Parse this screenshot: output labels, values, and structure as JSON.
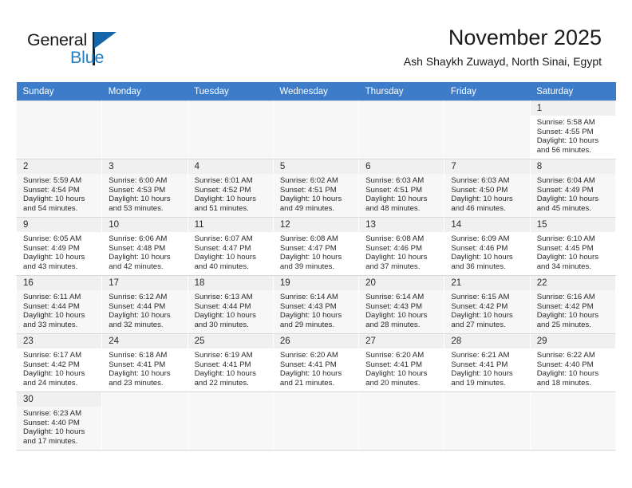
{
  "brand": {
    "name_part1": "General",
    "name_part2": "Blue",
    "accent_color": "#1f7fc4"
  },
  "header": {
    "title": "November 2025",
    "subtitle": "Ash Shaykh Zuwayd, North Sinai, Egypt"
  },
  "calendar": {
    "header_bg": "#3d7cc9",
    "weekdays": [
      "Sunday",
      "Monday",
      "Tuesday",
      "Wednesday",
      "Thursday",
      "Friday",
      "Saturday"
    ],
    "weeks": [
      [
        {
          "day": "",
          "sunrise": "",
          "sunset": "",
          "daylight1": "",
          "daylight2": ""
        },
        {
          "day": "",
          "sunrise": "",
          "sunset": "",
          "daylight1": "",
          "daylight2": ""
        },
        {
          "day": "",
          "sunrise": "",
          "sunset": "",
          "daylight1": "",
          "daylight2": ""
        },
        {
          "day": "",
          "sunrise": "",
          "sunset": "",
          "daylight1": "",
          "daylight2": ""
        },
        {
          "day": "",
          "sunrise": "",
          "sunset": "",
          "daylight1": "",
          "daylight2": ""
        },
        {
          "day": "",
          "sunrise": "",
          "sunset": "",
          "daylight1": "",
          "daylight2": ""
        },
        {
          "day": "1",
          "sunrise": "Sunrise: 5:58 AM",
          "sunset": "Sunset: 4:55 PM",
          "daylight1": "Daylight: 10 hours",
          "daylight2": "and 56 minutes."
        }
      ],
      [
        {
          "day": "2",
          "sunrise": "Sunrise: 5:59 AM",
          "sunset": "Sunset: 4:54 PM",
          "daylight1": "Daylight: 10 hours",
          "daylight2": "and 54 minutes."
        },
        {
          "day": "3",
          "sunrise": "Sunrise: 6:00 AM",
          "sunset": "Sunset: 4:53 PM",
          "daylight1": "Daylight: 10 hours",
          "daylight2": "and 53 minutes."
        },
        {
          "day": "4",
          "sunrise": "Sunrise: 6:01 AM",
          "sunset": "Sunset: 4:52 PM",
          "daylight1": "Daylight: 10 hours",
          "daylight2": "and 51 minutes."
        },
        {
          "day": "5",
          "sunrise": "Sunrise: 6:02 AM",
          "sunset": "Sunset: 4:51 PM",
          "daylight1": "Daylight: 10 hours",
          "daylight2": "and 49 minutes."
        },
        {
          "day": "6",
          "sunrise": "Sunrise: 6:03 AM",
          "sunset": "Sunset: 4:51 PM",
          "daylight1": "Daylight: 10 hours",
          "daylight2": "and 48 minutes."
        },
        {
          "day": "7",
          "sunrise": "Sunrise: 6:03 AM",
          "sunset": "Sunset: 4:50 PM",
          "daylight1": "Daylight: 10 hours",
          "daylight2": "and 46 minutes."
        },
        {
          "day": "8",
          "sunrise": "Sunrise: 6:04 AM",
          "sunset": "Sunset: 4:49 PM",
          "daylight1": "Daylight: 10 hours",
          "daylight2": "and 45 minutes."
        }
      ],
      [
        {
          "day": "9",
          "sunrise": "Sunrise: 6:05 AM",
          "sunset": "Sunset: 4:49 PM",
          "daylight1": "Daylight: 10 hours",
          "daylight2": "and 43 minutes."
        },
        {
          "day": "10",
          "sunrise": "Sunrise: 6:06 AM",
          "sunset": "Sunset: 4:48 PM",
          "daylight1": "Daylight: 10 hours",
          "daylight2": "and 42 minutes."
        },
        {
          "day": "11",
          "sunrise": "Sunrise: 6:07 AM",
          "sunset": "Sunset: 4:47 PM",
          "daylight1": "Daylight: 10 hours",
          "daylight2": "and 40 minutes."
        },
        {
          "day": "12",
          "sunrise": "Sunrise: 6:08 AM",
          "sunset": "Sunset: 4:47 PM",
          "daylight1": "Daylight: 10 hours",
          "daylight2": "and 39 minutes."
        },
        {
          "day": "13",
          "sunrise": "Sunrise: 6:08 AM",
          "sunset": "Sunset: 4:46 PM",
          "daylight1": "Daylight: 10 hours",
          "daylight2": "and 37 minutes."
        },
        {
          "day": "14",
          "sunrise": "Sunrise: 6:09 AM",
          "sunset": "Sunset: 4:46 PM",
          "daylight1": "Daylight: 10 hours",
          "daylight2": "and 36 minutes."
        },
        {
          "day": "15",
          "sunrise": "Sunrise: 6:10 AM",
          "sunset": "Sunset: 4:45 PM",
          "daylight1": "Daylight: 10 hours",
          "daylight2": "and 34 minutes."
        }
      ],
      [
        {
          "day": "16",
          "sunrise": "Sunrise: 6:11 AM",
          "sunset": "Sunset: 4:44 PM",
          "daylight1": "Daylight: 10 hours",
          "daylight2": "and 33 minutes."
        },
        {
          "day": "17",
          "sunrise": "Sunrise: 6:12 AM",
          "sunset": "Sunset: 4:44 PM",
          "daylight1": "Daylight: 10 hours",
          "daylight2": "and 32 minutes."
        },
        {
          "day": "18",
          "sunrise": "Sunrise: 6:13 AM",
          "sunset": "Sunset: 4:44 PM",
          "daylight1": "Daylight: 10 hours",
          "daylight2": "and 30 minutes."
        },
        {
          "day": "19",
          "sunrise": "Sunrise: 6:14 AM",
          "sunset": "Sunset: 4:43 PM",
          "daylight1": "Daylight: 10 hours",
          "daylight2": "and 29 minutes."
        },
        {
          "day": "20",
          "sunrise": "Sunrise: 6:14 AM",
          "sunset": "Sunset: 4:43 PM",
          "daylight1": "Daylight: 10 hours",
          "daylight2": "and 28 minutes."
        },
        {
          "day": "21",
          "sunrise": "Sunrise: 6:15 AM",
          "sunset": "Sunset: 4:42 PM",
          "daylight1": "Daylight: 10 hours",
          "daylight2": "and 27 minutes."
        },
        {
          "day": "22",
          "sunrise": "Sunrise: 6:16 AM",
          "sunset": "Sunset: 4:42 PM",
          "daylight1": "Daylight: 10 hours",
          "daylight2": "and 25 minutes."
        }
      ],
      [
        {
          "day": "23",
          "sunrise": "Sunrise: 6:17 AM",
          "sunset": "Sunset: 4:42 PM",
          "daylight1": "Daylight: 10 hours",
          "daylight2": "and 24 minutes."
        },
        {
          "day": "24",
          "sunrise": "Sunrise: 6:18 AM",
          "sunset": "Sunset: 4:41 PM",
          "daylight1": "Daylight: 10 hours",
          "daylight2": "and 23 minutes."
        },
        {
          "day": "25",
          "sunrise": "Sunrise: 6:19 AM",
          "sunset": "Sunset: 4:41 PM",
          "daylight1": "Daylight: 10 hours",
          "daylight2": "and 22 minutes."
        },
        {
          "day": "26",
          "sunrise": "Sunrise: 6:20 AM",
          "sunset": "Sunset: 4:41 PM",
          "daylight1": "Daylight: 10 hours",
          "daylight2": "and 21 minutes."
        },
        {
          "day": "27",
          "sunrise": "Sunrise: 6:20 AM",
          "sunset": "Sunset: 4:41 PM",
          "daylight1": "Daylight: 10 hours",
          "daylight2": "and 20 minutes."
        },
        {
          "day": "28",
          "sunrise": "Sunrise: 6:21 AM",
          "sunset": "Sunset: 4:41 PM",
          "daylight1": "Daylight: 10 hours",
          "daylight2": "and 19 minutes."
        },
        {
          "day": "29",
          "sunrise": "Sunrise: 6:22 AM",
          "sunset": "Sunset: 4:40 PM",
          "daylight1": "Daylight: 10 hours",
          "daylight2": "and 18 minutes."
        }
      ],
      [
        {
          "day": "30",
          "sunrise": "Sunrise: 6:23 AM",
          "sunset": "Sunset: 4:40 PM",
          "daylight1": "Daylight: 10 hours",
          "daylight2": "and 17 minutes."
        },
        {
          "day": "",
          "sunrise": "",
          "sunset": "",
          "daylight1": "",
          "daylight2": ""
        },
        {
          "day": "",
          "sunrise": "",
          "sunset": "",
          "daylight1": "",
          "daylight2": ""
        },
        {
          "day": "",
          "sunrise": "",
          "sunset": "",
          "daylight1": "",
          "daylight2": ""
        },
        {
          "day": "",
          "sunrise": "",
          "sunset": "",
          "daylight1": "",
          "daylight2": ""
        },
        {
          "day": "",
          "sunrise": "",
          "sunset": "",
          "daylight1": "",
          "daylight2": ""
        },
        {
          "day": "",
          "sunrise": "",
          "sunset": "",
          "daylight1": "",
          "daylight2": ""
        }
      ]
    ]
  }
}
